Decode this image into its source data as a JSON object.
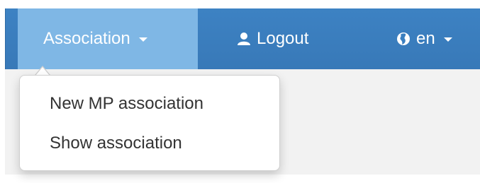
{
  "navbar": {
    "association_label": "Association",
    "logout_label": "Logout",
    "language_label": "en"
  },
  "dropdown": {
    "items": [
      {
        "label": "New MP association"
      },
      {
        "label": "Show association"
      }
    ]
  },
  "icons": {
    "association_caret": "caret-down-icon",
    "logout": "user-icon",
    "language": "globe-icon",
    "language_caret": "caret-down-icon"
  },
  "colors": {
    "navbar_bg": "#3a7fc0",
    "active_item_bg": "#7fb7e5",
    "dropdown_text": "#333333",
    "page_bg": "#f2f2f2"
  }
}
